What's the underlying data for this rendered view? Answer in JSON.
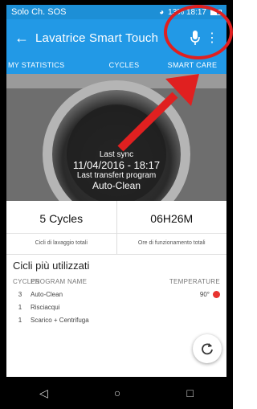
{
  "status_bar": {
    "carrier": "Solo Ch. SOS",
    "right_text": "13% 18:17"
  },
  "app_bar": {
    "title": "Lavatrice Smart Touch",
    "back_icon": "arrow-left-icon",
    "mic_icon": "microphone-icon",
    "more_icon": "more-vert-icon"
  },
  "tabs": [
    {
      "label": "MY STATISTICS"
    },
    {
      "label": "CYCLES"
    },
    {
      "label": "SMART CARE"
    }
  ],
  "hero": {
    "last_sync_label": "Last sync",
    "last_sync_value": "11/04/2016 - 18:17",
    "last_program_label": "Last transfert program",
    "last_program_value": "Auto-Clean"
  },
  "stats": [
    {
      "value": "5 Cycles",
      "caption": "Cicli di lavaggio totali"
    },
    {
      "value": "06H26M",
      "caption": "Ore di funzionamento totali"
    }
  ],
  "most_used": {
    "heading": "Cicli più utilizzati",
    "columns": {
      "cycles": "CYCLES",
      "program": "PROGRAM NAME",
      "temperature": "TEMPERATURE"
    },
    "rows": [
      {
        "cycles": "3",
        "program": "Auto-Clean",
        "temperature": "90°"
      },
      {
        "cycles": "1",
        "program": "Risciacqui",
        "temperature": ""
      },
      {
        "cycles": "1",
        "program": "Scarico + Centrifuga",
        "temperature": ""
      }
    ]
  },
  "colors": {
    "primary": "#2299e6",
    "status": "#1d8fd6",
    "accent_red": "#e02020"
  }
}
